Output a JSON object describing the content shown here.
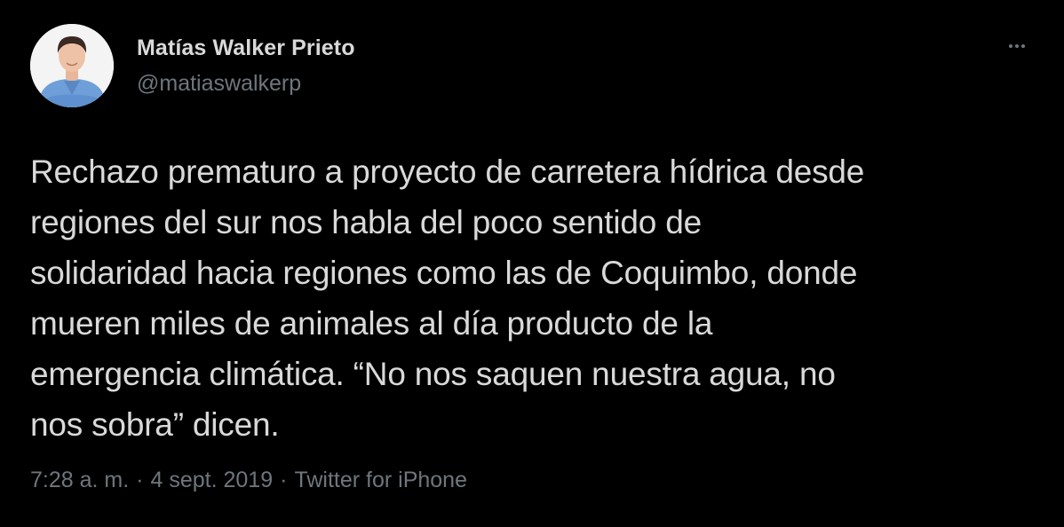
{
  "author": {
    "name": "Matías Walker Prieto",
    "handle": "@matiaswalkerp"
  },
  "tweet": {
    "text": "Rechazo prematuro a proyecto de carretera hídrica desde\nregiones del sur nos habla del poco sentido de\nsolidaridad hacia regiones como las de Coquimbo, donde\nmueren miles de animales al día producto de la\nemergencia climática. “No nos saquen nuestra agua, no\nnos sobra” dicen.",
    "time": "7:28 a. m.",
    "date": "4 sept. 2019",
    "source": "Twitter for iPhone",
    "separator": "·"
  },
  "icons": {
    "more": "more-horizontal-icon"
  },
  "colors": {
    "background": "#000000",
    "primary_text": "#d9d9d9",
    "secondary_text": "#6e767d"
  }
}
